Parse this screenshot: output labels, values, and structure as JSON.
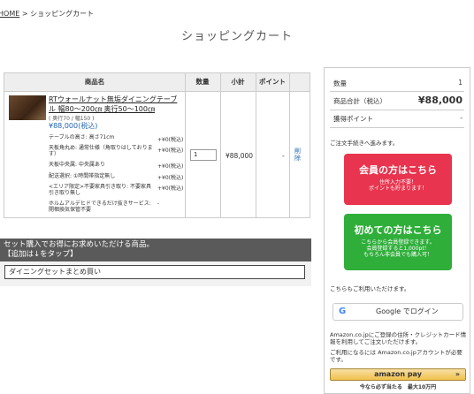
{
  "breadcrumb": {
    "home": "HOME",
    "sep": ">",
    "current": "ショッピングカート"
  },
  "page_title": "ショッピングカート",
  "cart": {
    "headers": {
      "name": "商品名",
      "qty": "数量",
      "subtotal": "小計",
      "points": "ポイント"
    },
    "item": {
      "name": "RTウォールナット無垢ダイニングテーブル 幅80～200㎝ 奥行50～100㎝",
      "size_note": "( 奥行70 / 幅150 )",
      "price": "¥88,000(税込)",
      "options": [
        {
          "label": "テーブルの高さ: 高さ71cm",
          "price": ""
        },
        {
          "label": "天板角丸め: 通常仕様（角取りはしております）",
          "price": "+¥0(税込)"
        },
        {
          "label": "天板中央属: 中央属あり",
          "price": "+¥0(税込)"
        },
        {
          "label": "配送選択: ①時間帯指定無し",
          "price": "+¥0(税込)"
        },
        {
          "label": "<エリア限定>不要家具引き取り: 不要家具引き取り無し",
          "price": "+¥0(税込)"
        },
        {
          "label": "ホルムアルデヒドできるだけ抜きサービス: 開梱換気保管不要",
          "price": "-"
        }
      ],
      "option_first_price": "+¥0(税込)",
      "quantity": "1",
      "subtotal": "¥88,000",
      "points": "-",
      "delete_label": "削除"
    }
  },
  "set_section": {
    "banner_line1": "セット購入でお得にお求めいただける商品。",
    "banner_line2": "【追加は↓をタップ】",
    "select_value": "ダイニングセットまとめ買い"
  },
  "summary": {
    "qty_label": "数量",
    "qty_value": "1",
    "total_label": "商品合計（税込）",
    "total_value": "¥88,000",
    "points_label": "獲得ポイント",
    "points_value": "-",
    "proceed_text": "ご注文手続きへ進みます。",
    "member_button": {
      "title": "会員の方はこちら",
      "line1": "住所入力不要！",
      "line2": "ポイントも貯まります！",
      "color": "#e8344e"
    },
    "new_button": {
      "title": "初めての方はこちら",
      "line1": "こちらから会員登録できます。",
      "line2": "会員登録すると1,000pt！",
      "line3": "もちろん非会員でも購入可！",
      "color": "#2fae3a"
    },
    "also_text": "こちらもご利用いただけます。",
    "google_label": "Google でログイン",
    "amazon_text1": "Amazon.co.jpにご登録の住所・クレジットカード情報を利用してご注文いただけます。",
    "amazon_text2": "ご利用になるには Amazon.co.jpアカウントが必要です。",
    "amazon_pay_label": "amazon pay",
    "amazon_note": "今なら必ず当たる　最大10万円"
  }
}
